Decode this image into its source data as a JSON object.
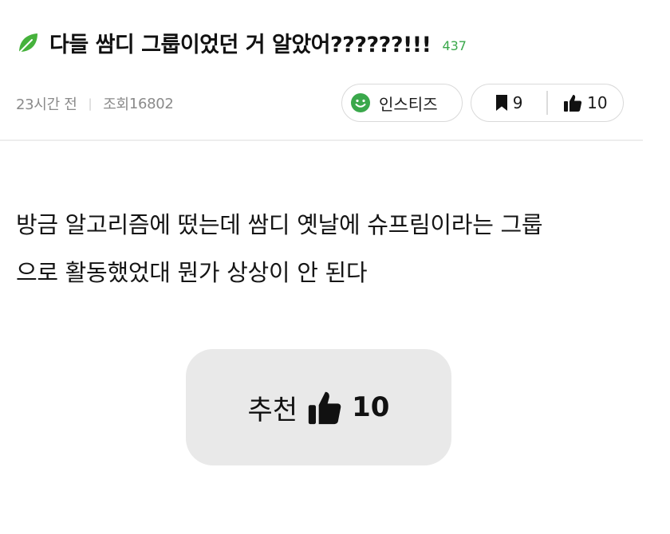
{
  "post": {
    "title": "다들 쌈디 그룹이었던 거 알았어??????!!!",
    "comment_count": "437",
    "time_ago": "23시간 전",
    "view_label": "조회",
    "view_count": "16802",
    "board_name": "인스티즈",
    "scrap_count": "9",
    "like_count": "10",
    "body_lines": [
      "방금 알고리즘에 떴는데 쌈디 옛날에 슈프림이라는 그룹",
      "으로 활동했었대 뭔가 상상이 안 된다"
    ]
  },
  "recommend": {
    "label": "추천",
    "count": "10"
  },
  "colors": {
    "accent_green": "#3aa84b",
    "leaf_green": "#46b23c",
    "button_bg": "#e9e9e9",
    "meta_gray": "#8a8a8a"
  },
  "icons": {
    "title": "leaf-icon",
    "board": "smiley-icon",
    "scrap": "bookmark-icon",
    "like": "thumbs-up-icon"
  }
}
